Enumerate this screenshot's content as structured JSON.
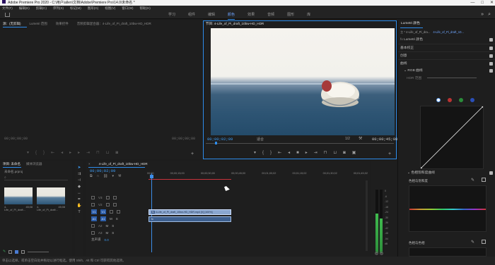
{
  "app": {
    "title": "Adobe Premiere Pro 2020 - C:\\用户\\allen\\文档\\Adobe\\Premiere Pro\\14.0\\未命名 *",
    "window_controls": [
      "—",
      "□",
      "✕"
    ]
  },
  "menu": [
    "文件(F)",
    "编辑(E)",
    "剪辑(C)",
    "序列(S)",
    "标记(M)",
    "图形(G)",
    "视图(V)",
    "窗口(W)",
    "帮助(H)"
  ],
  "workspaces": [
    {
      "label": "学习",
      "active": false
    },
    {
      "label": "组件",
      "active": false
    },
    {
      "label": "编辑",
      "active": false
    },
    {
      "label": "颜色",
      "active": true
    },
    {
      "label": "效果",
      "active": false
    },
    {
      "label": "音频",
      "active": false
    },
    {
      "label": "图形",
      "active": false
    },
    {
      "label": "库",
      "active": false
    }
  ],
  "source_panel": {
    "tabs": [
      "源：(无剪辑)",
      "Lumetri 范围",
      "效果控件",
      "音频剪辑混合器：4-Life_of_Pi_draft_10bw-HD_HDR"
    ],
    "timecode_left": "00;00;00;00",
    "timecode_right": "00;00;00;00"
  },
  "program_panel": {
    "title": "节目: 4-Life_of_Pi_draft_10bw-HD_HDR",
    "timecode": "00;00;02;09",
    "fit": "适合",
    "quality": "1/2",
    "duration": "00;00;45;08"
  },
  "lumetri": {
    "title": "Lumetri 颜色",
    "source_row": "主 * 4-Life_of_Pi_dra...",
    "seq_row": "4-Life_of_Pi_draft_10...",
    "preset": "Lumetri 颜色",
    "sections": [
      "基本校正",
      "创意",
      "曲线"
    ],
    "rgb_curve": "RGB 曲线",
    "hdr_label": "HDR 范围",
    "hsl_label": "色相饱和度曲线",
    "hue_vs_sat": "色相与饱和度",
    "hue_vs_hue": "色相与色相"
  },
  "project_panel": {
    "tabs": [
      "项目: 未命名",
      "媒体浏览器"
    ],
    "file": "未命名.prproj",
    "items": [
      {
        "name": "4-Life_of_Pi_draft...",
        "duration": "45;08"
      },
      {
        "name": "4-Life_of_Pi_draft...",
        "duration": "45;08"
      }
    ]
  },
  "timeline": {
    "tab": "4-Life_of_Pi_draft_10bw-HD_HDR",
    "timecode": "00;00;02;09",
    "ruler": [
      "00;00",
      "00;00;15;00",
      "00;00;30;00",
      "00;00;45;00",
      "00;01;00;02",
      "00;01;15;02",
      "00;01;30;02",
      "00;01;45;02"
    ],
    "video_tracks": [
      "V3",
      "V2",
      "V1"
    ],
    "audio_tracks": [
      "A1",
      "A2",
      "A3"
    ],
    "master_label": "主声道",
    "master_value": "0.0",
    "clip_video": "4-Life_of_Pi_draft_10bw-HD_HDR.mp4 [V] [100%]",
    "clip_audio_marker": "fx",
    "playhead_fraction": 0.05
  },
  "meter": {
    "scale": [
      "0",
      "-6",
      "-12",
      "-18",
      "-24",
      "-30",
      "-36",
      "-42",
      "-48",
      "-54",
      "dB"
    ],
    "left_level": 0.62,
    "right_level": 0.55,
    "buttons": [
      "S",
      "S"
    ]
  },
  "status": "单击以选择，或单击空白处并拖动以进行框选。使用 Shift、Alt 和 Ctrl 可获得其他选项。"
}
